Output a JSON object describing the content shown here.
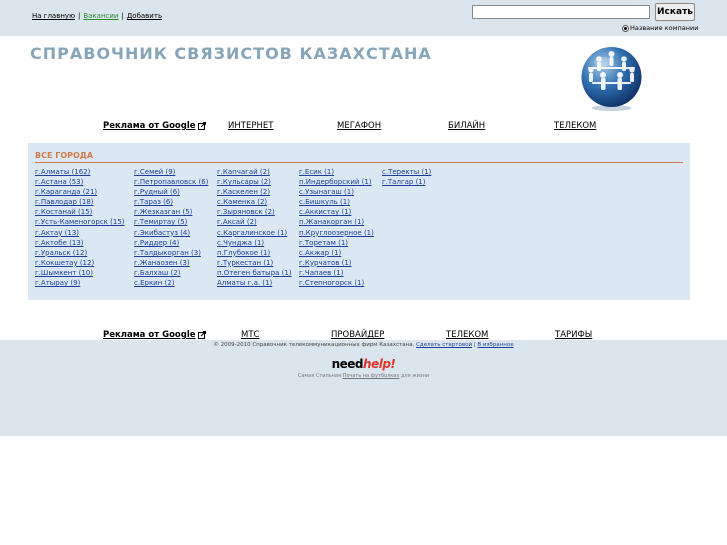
{
  "top_links": {
    "home": "На главную",
    "vacancies": "Вакансии",
    "add": "Добавить",
    "separator": "|"
  },
  "search": {
    "value": "",
    "button_label": "Искать",
    "radio_label": "Название компании"
  },
  "site": {
    "title": "СПРАВОЧНИК СВЯЗИСТОВ КАЗАХСТАНА"
  },
  "top_menu": {
    "ads": "Реклама от Google",
    "items": [
      "ИНТЕРНЕТ",
      "МЕГАФОН",
      "БИЛАЙН",
      "ТЕЛЕКОМ"
    ]
  },
  "cities_panel": {
    "header": "ВСЕ ГОРОДА",
    "columns": [
      [
        "г.Алматы (162)",
        "г.Астана (53)",
        "г.Караганда (21)",
        "г.Павлодар (18)",
        "г.Костанай (15)",
        "г.Усть-Каменогорск (15)",
        "г.Актау (13)",
        "г.Актобе (13)",
        "г.Уральск (12)",
        "г.Кокшетау (12)",
        "г.Шымкент (10)",
        "г.Атырау (9)"
      ],
      [
        "г.Семей (9)",
        "г.Петропавловск (6)",
        "г.Рудный (6)",
        "г.Тараз (6)",
        "г.Жезказган (5)",
        "г.Темиртау (5)",
        "г.Экибастуз (4)",
        "г.Риддер (4)",
        "г.Талдыкорган (3)",
        "г.Жанаозен (3)",
        "г.Балхаш (2)",
        "с.Еркин (2)"
      ],
      [
        "г.Капчагай (2)",
        "г.Кульсары (2)",
        "г.Каскелен (2)",
        "с.Каменка (2)",
        "г.Зыряновск (2)",
        "г.Аксай (2)",
        "с.Каргалинское (1)",
        "с.Чунджа (1)",
        "п.Глубокое (1)",
        "г.Туркестан (1)",
        "п.Отеген батыра (1)",
        "Алматы г.а. (1)"
      ],
      [
        "г.Есик (1)",
        "п.Индерборский (1)",
        "с.Узынагаш (1)",
        "с.Бишкуль (1)",
        "с.Аккистау (1)",
        "п.Жанакорган (1)",
        "п.Круглоозерное (1)",
        "г.Торетам (1)",
        "с.Акжар (1)",
        "г.Курчатов (1)",
        "г.Чапаев (1)",
        "г.Степногорск (1)"
      ],
      [
        "с.Теректы (1)",
        "г.Талгар (1)"
      ]
    ]
  },
  "bottom_menu": {
    "ads": "Реклама от Google",
    "items": [
      "МТС",
      "ПРОВАЙДЕР",
      "ТЕЛЕКОМ",
      "ТАРИФЫ"
    ]
  },
  "footer": {
    "copyright": "© 2009-2010 Справочник телекоммуникационных фирм Казахстана.",
    "start_link": "Сделать стартовой",
    "separator": "|",
    "favorites_link": "В избранное",
    "needhelp_need": "need",
    "needhelp_help": "help!",
    "needhelp_before": "Самая Стильная",
    "needhelp_link": "Печать на футболках",
    "needhelp_after": "для жизни"
  },
  "colors": {
    "band": "#dbe5ee",
    "panel": "#dbe8f3",
    "title": "#87a5b8",
    "header_accent": "#d27a4d",
    "link": "#1d3f97"
  }
}
